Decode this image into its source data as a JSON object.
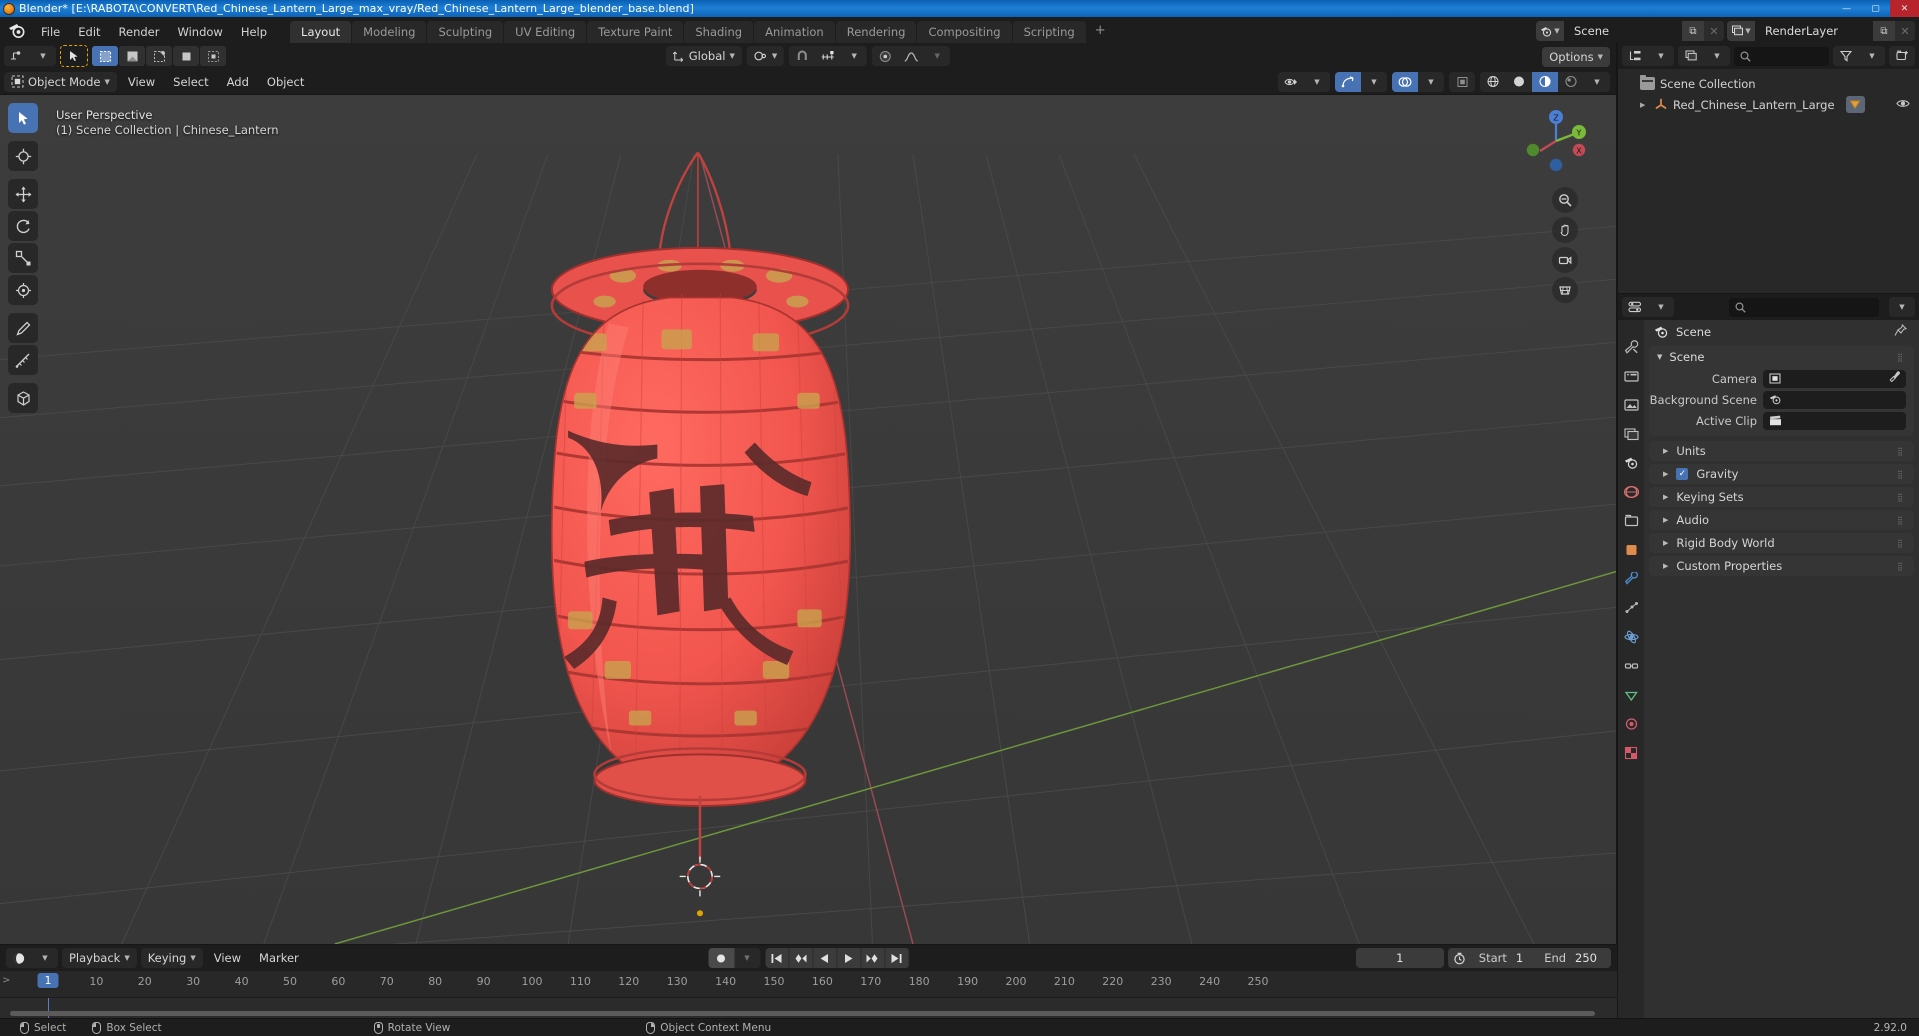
{
  "window": {
    "title": "Blender* [E:\\RABOTA\\CONVERT\\Red_Chinese_Lantern_Large_max_vray/Red_Chinese_Lantern_Large_blender_base.blend]",
    "minimize": "—",
    "maximize": "▢",
    "close": "✕"
  },
  "topbar": {
    "menus": [
      "File",
      "Edit",
      "Render",
      "Window",
      "Help"
    ],
    "workspaces": [
      {
        "label": "Layout",
        "active": true
      },
      {
        "label": "Modeling",
        "active": false
      },
      {
        "label": "Sculpting",
        "active": false
      },
      {
        "label": "UV Editing",
        "active": false
      },
      {
        "label": "Texture Paint",
        "active": false
      },
      {
        "label": "Shading",
        "active": false
      },
      {
        "label": "Animation",
        "active": false
      },
      {
        "label": "Rendering",
        "active": false
      },
      {
        "label": "Compositing",
        "active": false
      },
      {
        "label": "Scripting",
        "active": false
      }
    ],
    "add_workspace": "+",
    "scene_name": "Scene",
    "viewlayer_name": "RenderLayer",
    "copy_glyph": "⧉",
    "x_glyph": "✕"
  },
  "viewport": {
    "mode": "Object Mode",
    "menus": [
      "View",
      "Select",
      "Add",
      "Object"
    ],
    "transform_orientation": "Global",
    "options_label": "Options",
    "overlay_line1": "User Perspective",
    "overlay_line2": "(1) Scene Collection | Chinese_Lantern",
    "gizmo_axes": {
      "z": "Z",
      "y": "Y",
      "x": "X"
    },
    "nav_buttons": [
      "zoom-icon",
      "pan-hand-icon",
      "camera-icon",
      "ortho-persp-icon"
    ],
    "tools": [
      {
        "name": "tweak-select-tool",
        "glyph": "▶",
        "active": true
      },
      {
        "name": "cursor-tool",
        "glyph": "⊕",
        "active": false
      },
      {
        "name": "move-tool",
        "glyph": "✥",
        "active": false
      },
      {
        "name": "rotate-tool",
        "glyph": "⟳",
        "active": false
      },
      {
        "name": "scale-tool",
        "glyph": "⤢",
        "active": false
      },
      {
        "name": "transform-tool",
        "glyph": "✦",
        "active": false
      },
      {
        "name": "annotate-tool",
        "glyph": "✎",
        "active": false
      },
      {
        "name": "measure-tool",
        "glyph": "📏",
        "active": false
      },
      {
        "name": "add-cube-tool",
        "glyph": "⬚",
        "active": false
      }
    ]
  },
  "outliner": {
    "search_placeholder": "",
    "rows": [
      {
        "label": "Scene Collection",
        "indent": 0,
        "icon": "collection-icon",
        "disclosure": "",
        "has_eye": false
      },
      {
        "label": "Red_Chinese_Lantern_Large",
        "indent": 1,
        "icon": "mesh-object-icon",
        "disclosure": "▶",
        "has_eye": true
      }
    ]
  },
  "properties": {
    "breadcrumb": "Scene",
    "panel_title": "Scene",
    "rows": [
      {
        "label": "Camera",
        "value": "",
        "field_icon": "camera-icon",
        "has_eyedropper": true
      },
      {
        "label": "Background Scene",
        "value": "",
        "field_icon": "scene-icon",
        "has_eyedropper": false
      },
      {
        "label": "Active Clip",
        "value": "",
        "field_icon": "clip-icon",
        "has_eyedropper": false
      }
    ],
    "closed_panels": [
      {
        "label": "Units",
        "checkbox": null
      },
      {
        "label": "Gravity",
        "checkbox": true
      },
      {
        "label": "Keying Sets",
        "checkbox": null
      },
      {
        "label": "Audio",
        "checkbox": null
      },
      {
        "label": "Rigid Body World",
        "checkbox": null
      },
      {
        "label": "Custom Properties",
        "checkbox": null
      }
    ],
    "tabs": [
      "tool-icon",
      "render-icon",
      "output-icon",
      "viewlayer-icon",
      "scene-icon",
      "world-icon",
      "collection-icon",
      "object-icon",
      "modifier-icon",
      "particles-icon",
      "physics-icon",
      "constraint-icon",
      "data-icon",
      "material-icon",
      "texture-icon"
    ]
  },
  "timeline": {
    "menus": [
      "Playback",
      "Keying",
      "View",
      "Marker"
    ],
    "current_frame": "1",
    "start_label": "Start",
    "start_value": "1",
    "end_label": "End",
    "end_value": "250",
    "ticks": [
      "1",
      "10",
      "20",
      "30",
      "40",
      "50",
      "60",
      "70",
      "80",
      "90",
      "100",
      "110",
      "120",
      "130",
      "140",
      "150",
      "160",
      "170",
      "180",
      "190",
      "200",
      "210",
      "220",
      "230",
      "240",
      "250"
    ],
    "transport": [
      "⏮",
      "⏪",
      "◀",
      "▶",
      "⏩",
      "⏭"
    ],
    "record_glyph": "●"
  },
  "statusbar": {
    "items": [
      {
        "mouse": "left",
        "label": "Select"
      },
      {
        "mouse": "left-drag",
        "label": "Box Select"
      },
      {
        "mouse": "middle",
        "label": "Rotate View"
      },
      {
        "mouse": "right",
        "label": "Object Context Menu"
      }
    ],
    "version": "2.92.0"
  },
  "colors": {
    "accent_blue": "#4772b3",
    "title_blue": "#1e7fd4",
    "lantern_red": "#f0534c",
    "grid_gray": "#4a4a4a",
    "axis_green": "#7aba3a",
    "axis_red": "#c44a55"
  }
}
